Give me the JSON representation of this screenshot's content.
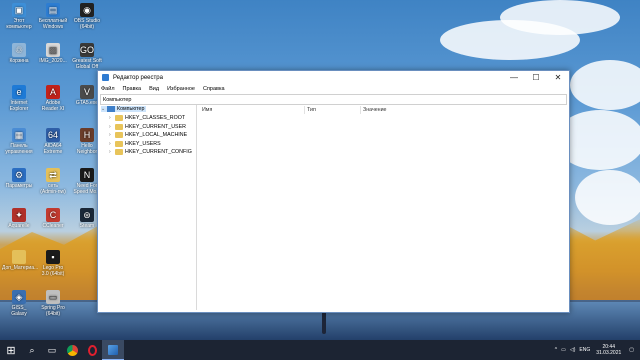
{
  "desktop": {
    "icons": [
      {
        "label": "Этот\nкомпьютер",
        "icon": "computer-icon",
        "color": "#3d8fd8"
      },
      {
        "label": "Корзина",
        "icon": "recycle-bin-icon",
        "color": "#8fb5d8"
      },
      {
        "label": "Internet\nExplorer",
        "icon": "ie-icon",
        "color": "#1e7ad6"
      },
      {
        "label": "Панель\nуправления",
        "icon": "control-panel-icon",
        "color": "#4a8cd4"
      },
      {
        "label": "Параметры",
        "icon": "gear-icon",
        "color": "#2b6ec2"
      },
      {
        "label": "Aquarelle",
        "icon": "app-icon",
        "color": "#b0302a"
      },
      {
        "label": "Доп_Материа...",
        "icon": "folder-icon",
        "color": "#e4c05a"
      },
      {
        "label": "GISS_\nGalaxy",
        "icon": "app-icon",
        "color": "#3a6fb0"
      },
      {
        "label": "Бесплатный\nWindows",
        "icon": "app-icon",
        "color": "#2d7dd2"
      },
      {
        "label": "IMG_2020...",
        "icon": "image-icon",
        "color": "#d8d8d8"
      },
      {
        "label": "Adobe\nReader XI",
        "icon": "pdf-icon",
        "color": "#c1221a"
      },
      {
        "label": "AIDA64\nExtreme",
        "icon": "app-icon",
        "color": "#2f5fa8"
      },
      {
        "label": "сеть\n(Admin-nw)",
        "icon": "network-icon",
        "color": "#e4c05a"
      },
      {
        "label": "CCleaner",
        "icon": "app-icon",
        "color": "#c23a2f"
      },
      {
        "label": "Lego Pro\n3.0 (64bit)",
        "icon": "app-icon",
        "color": "#1b1b1b"
      },
      {
        "label": "Spring Pro\n(64bit)",
        "icon": "app-icon",
        "color": "#bfbfbf"
      },
      {
        "label": "OBS Studio\n(64bit)",
        "icon": "app-icon",
        "color": "#222"
      },
      {
        "label": "Greatest Soft\nGlobal Off",
        "icon": "app-icon",
        "color": "#3a3a3a"
      },
      {
        "label": "GTA5.exe",
        "icon": "app-icon",
        "color": "#4b4b4b"
      },
      {
        "label": "Hello\nNeighbor",
        "icon": "app-icon",
        "color": "#6b3d2a"
      },
      {
        "label": "Need For\nSpeed Mo...",
        "icon": "app-icon",
        "color": "#1a1a1a"
      },
      {
        "label": "Steam",
        "icon": "steam-icon",
        "color": "#1b2838"
      }
    ]
  },
  "window": {
    "title": "Редактор реестра",
    "controls": {
      "minimize": "—",
      "maximize": "☐",
      "close": "✕"
    },
    "menu": [
      "Файл",
      "Правка",
      "Вид",
      "Избранное",
      "Справка"
    ],
    "address": "Компьютер",
    "tree": {
      "root": "Компьютер",
      "children": [
        "HKEY_CLASSES_ROOT",
        "HKEY_CURRENT_USER",
        "HKEY_LOCAL_MACHINE",
        "HKEY_USERS",
        "HKEY_CURRENT_CONFIG"
      ]
    },
    "columns": [
      "Имя",
      "Тип",
      "Значение"
    ]
  },
  "taskbar": {
    "start": "⊞",
    "search": "⌕",
    "taskview": "▭",
    "apps": [
      "chrome-icon",
      "opera-icon",
      "regedit-icon"
    ],
    "tray": {
      "chevron": "^",
      "language": "ENG",
      "time": "20:44",
      "date": "31.03.2021"
    }
  }
}
